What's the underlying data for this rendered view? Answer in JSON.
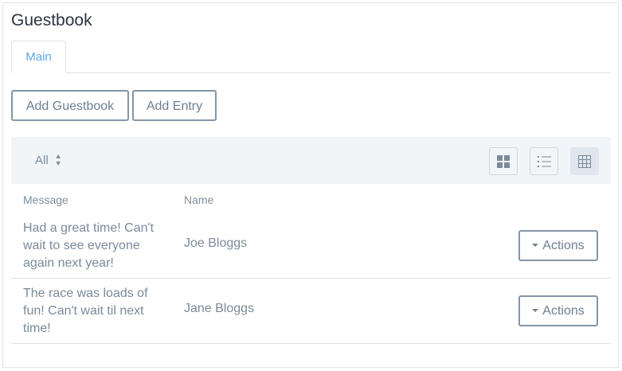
{
  "page": {
    "title": "Guestbook"
  },
  "tabs": [
    {
      "label": "Main"
    }
  ],
  "toolbar": {
    "add_guestbook_label": "Add Guestbook",
    "add_entry_label": "Add Entry"
  },
  "filter": {
    "selected": "All",
    "sort_icon": "sort-icon"
  },
  "view_modes": [
    {
      "icon": "grid-view-icon",
      "active": false
    },
    {
      "icon": "list-view-icon",
      "active": false
    },
    {
      "icon": "table-view-icon",
      "active": true
    }
  ],
  "table": {
    "columns": [
      "Message",
      "Name"
    ],
    "rows": [
      {
        "message": "Had a great time! Can't wait to see everyone again next year!",
        "name": "Joe Bloggs",
        "action_label": "Actions"
      },
      {
        "message": "The race was loads of fun! Can't wait til next time!",
        "name": "Jane Bloggs",
        "action_label": "Actions"
      }
    ]
  },
  "colors": {
    "accent": "#5aa9e6",
    "toolbar_bg": "#f2f5f8",
    "text": "#7a8a9a",
    "title": "#2c3440"
  }
}
